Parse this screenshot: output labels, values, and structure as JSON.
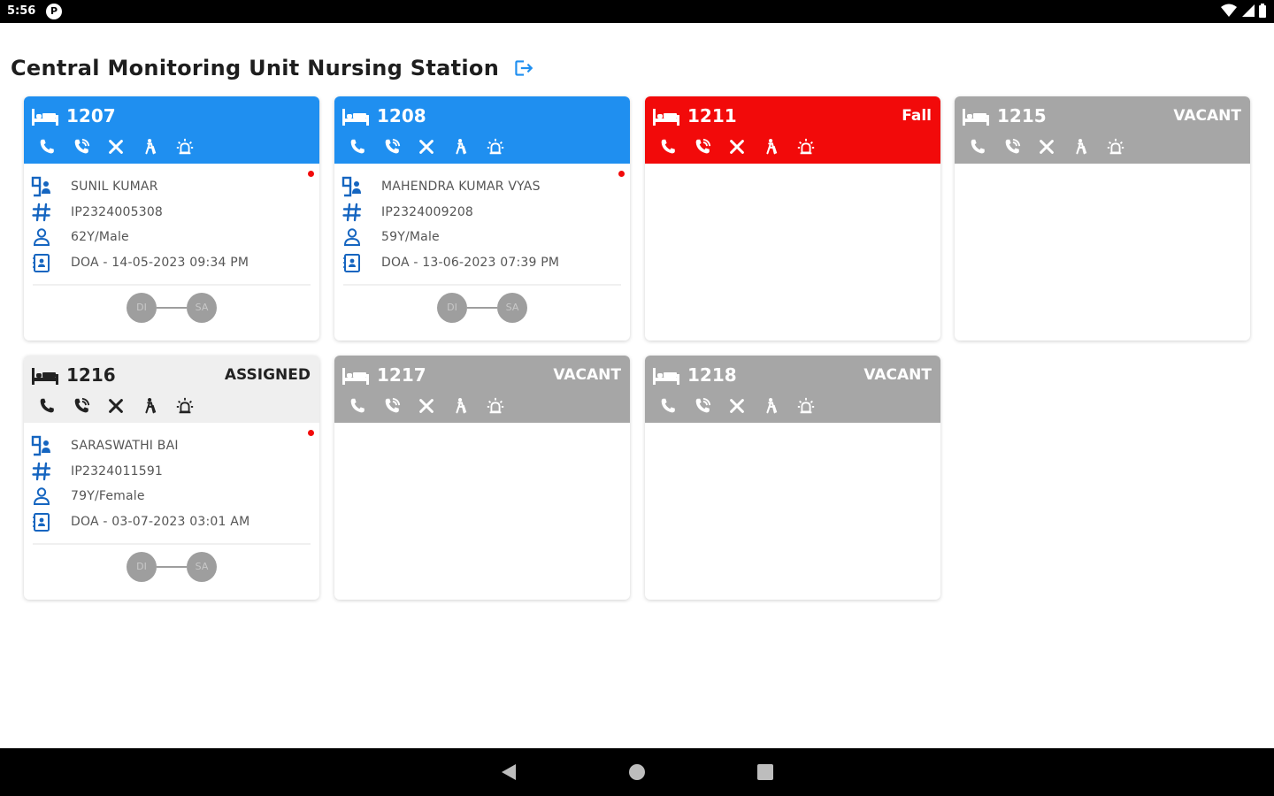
{
  "statusbar": {
    "time": "5:56",
    "notif_glyph": "P"
  },
  "header": {
    "title": "Central Monitoring Unit Nursing Station"
  },
  "beds": [
    {
      "bed": "1207",
      "status": "",
      "theme": "blue",
      "patient": {
        "name": "SUNIL KUMAR",
        "ip": "IP2324005308",
        "age_gender": "62Y/Male",
        "doa": "DOA - 14-05-2023 09:34 PM"
      },
      "flow": [
        "DI",
        "SA"
      ]
    },
    {
      "bed": "1208",
      "status": "",
      "theme": "blue",
      "patient": {
        "name": "MAHENDRA KUMAR VYAS",
        "ip": "IP2324009208",
        "age_gender": "59Y/Male",
        "doa": "DOA - 13-06-2023 07:39 PM"
      },
      "flow": [
        "DI",
        "SA"
      ]
    },
    {
      "bed": "1211",
      "status": "Fall",
      "theme": "red"
    },
    {
      "bed": "1215",
      "status": "VACANT",
      "theme": "gray"
    },
    {
      "bed": "1216",
      "status": "ASSIGNED",
      "theme": "light",
      "patient": {
        "name": "SARASWATHI BAI",
        "ip": "IP2324011591",
        "age_gender": "79Y/Female",
        "doa": "DOA - 03-07-2023 03:01 AM"
      },
      "flow": [
        "DI",
        "SA"
      ]
    },
    {
      "bed": "1217",
      "status": "VACANT",
      "theme": "gray"
    },
    {
      "bed": "1218",
      "status": "VACANT",
      "theme": "gray"
    }
  ],
  "colors": {
    "blue": "#1f8ff0",
    "red": "#f20a0a",
    "gray": "#a6a6a6",
    "light": "#efefef",
    "icon_blue": "#1565c0"
  }
}
